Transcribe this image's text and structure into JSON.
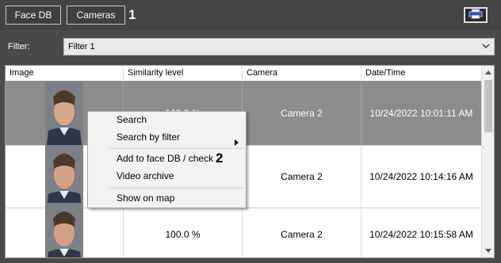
{
  "toolbar": {
    "face_db_label": "Face DB",
    "cameras_label": "Cameras",
    "callout_1": "1",
    "print_icon": "printer-icon"
  },
  "filter": {
    "label": "Filter:",
    "value": "Filter 1"
  },
  "table": {
    "columns": [
      "Image",
      "Similarity level",
      "Camera",
      "Date/Time"
    ],
    "rows": [
      {
        "similarity": "100.0 %",
        "camera": "Camera 2",
        "datetime": "10/24/2022 10:01:11 AM",
        "selected": true
      },
      {
        "similarity": "",
        "camera": "Camera 2",
        "datetime": "10/24/2022 10:14:16 AM",
        "selected": false
      },
      {
        "similarity": "100.0 %",
        "camera": "Camera 2",
        "datetime": "10/24/2022 10:15:58 AM",
        "selected": false
      }
    ]
  },
  "context_menu": {
    "items": [
      "Search",
      "Search by filter",
      "Add to face DB / check",
      "Video archive",
      "Show on map"
    ],
    "callout_2": "2"
  },
  "colors": {
    "background": "#4a4a4a",
    "selected_row": "#8c8c8c",
    "menu_bg": "#f2f2f2"
  }
}
